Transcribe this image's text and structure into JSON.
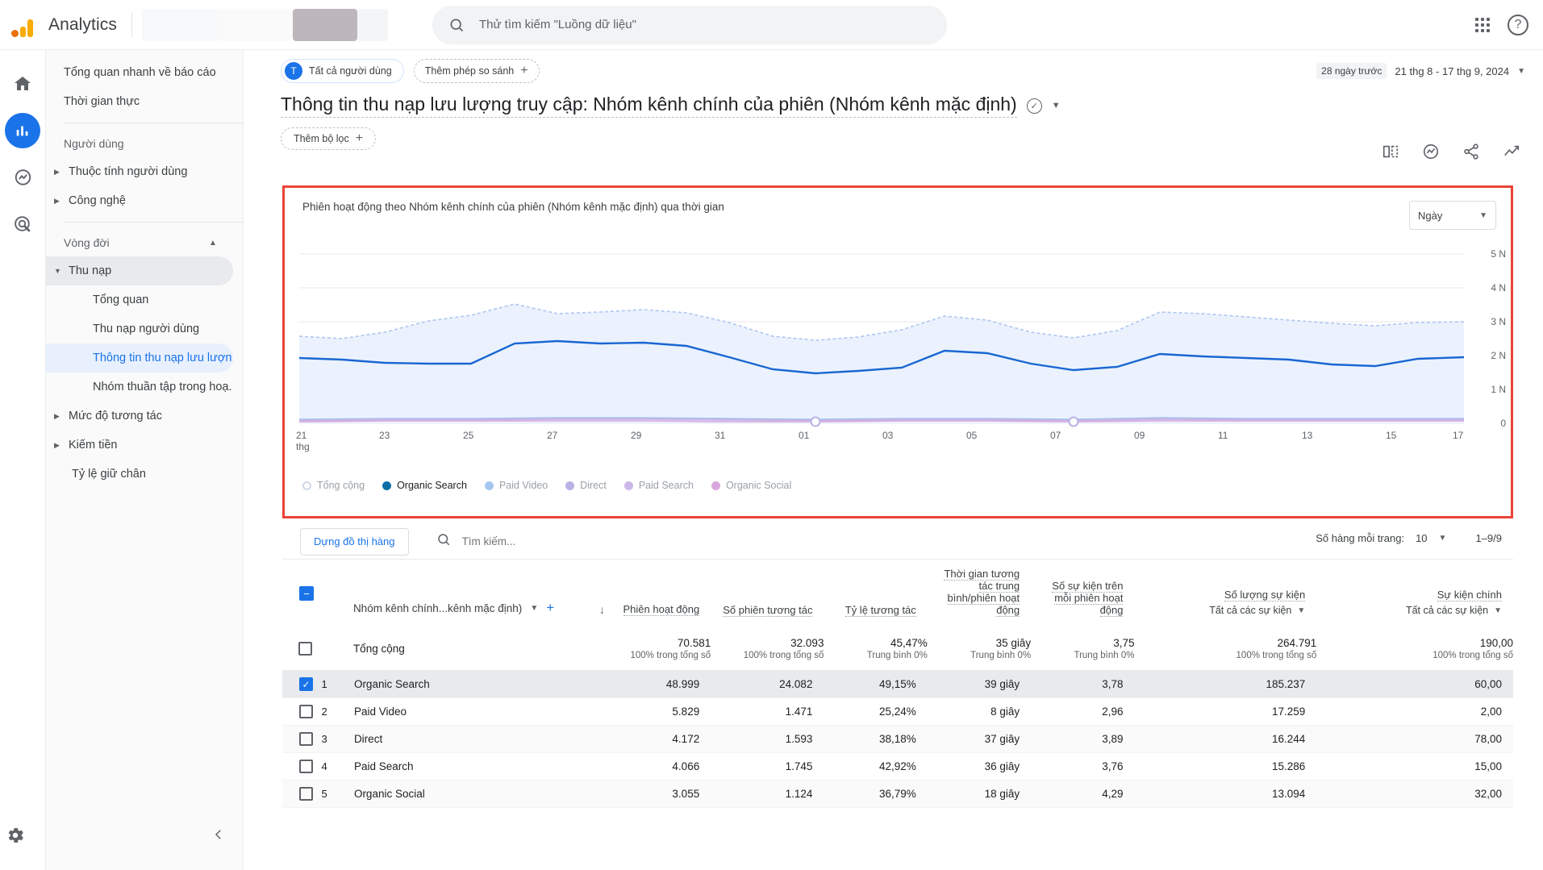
{
  "topbar": {
    "brand": "Analytics",
    "search_placeholder": "Thử tìm kiếm \"Luồng dữ liệu\"",
    "search_value": "",
    "search_icon": "search-icon",
    "apps_icon": "apps-grid-icon",
    "help_icon": "help-icon"
  },
  "rail": {
    "items": [
      {
        "name": "home",
        "icon": "home-icon"
      },
      {
        "name": "reports",
        "icon": "bar-chart-icon"
      },
      {
        "name": "explore",
        "icon": "explore-icon"
      },
      {
        "name": "advertising",
        "icon": "advertising-icon"
      }
    ],
    "settings_icon": "gear-icon"
  },
  "sidebar": {
    "items": [
      {
        "label": "Tổng quan nhanh về báo cáo",
        "type": "link"
      },
      {
        "label": "Thời gian thực",
        "type": "link"
      },
      {
        "label": "Người dùng",
        "type": "group"
      },
      {
        "label": "Thuộc tính người dùng",
        "type": "expandable"
      },
      {
        "label": "Công nghệ",
        "type": "expandable"
      },
      {
        "label": "Vòng đời",
        "type": "group"
      },
      {
        "label": "Thu nạp",
        "type": "expanded"
      },
      {
        "label": "Tổng quan",
        "type": "sub"
      },
      {
        "label": "Thu nạp người dùng",
        "type": "sub"
      },
      {
        "label": "Thông tin thu nạp lưu lượn...",
        "type": "sub-selected"
      },
      {
        "label": "Nhóm thuần tập trong hoạ...",
        "type": "sub"
      },
      {
        "label": "Mức độ tương tác",
        "type": "expandable"
      },
      {
        "label": "Kiếm tiền",
        "type": "expandable"
      },
      {
        "label": "Tỷ lệ giữ chân",
        "type": "link"
      }
    ],
    "collapse_icon": "chevron-left-icon"
  },
  "comparison": {
    "all_users_label": "Tất cả người dùng",
    "all_users_initial": "T",
    "add_comparison_label": "Thêm phép so sánh",
    "add_icon": "plus-icon"
  },
  "date_range": {
    "badge": "28 ngày trước",
    "range": "21 thg 8 - 17 thg 9, 2024",
    "caret_icon": "chevron-down-icon"
  },
  "report": {
    "title": "Thông tin thu nạp lưu lượng truy cập: Nhóm kênh chính của phiên (Nhóm kênh mặc định)",
    "verified_icon": "check-circle-icon",
    "title_caret_icon": "chevron-down-icon",
    "filter_label": "Thêm bộ lọc",
    "filter_plus_icon": "plus-icon",
    "actions": [
      {
        "name": "compare-icon"
      },
      {
        "name": "insights-icon"
      },
      {
        "name": "share-icon"
      },
      {
        "name": "trend-icon"
      }
    ]
  },
  "chart_data": {
    "type": "line",
    "title": "Phiên hoạt động theo Nhóm kênh chính của phiên (Nhóm kênh mặc định) qua thời gian",
    "granularity_label": "Ngày",
    "granularity_caret_icon": "chevron-down-icon",
    "xlabel": "",
    "ylabel": "",
    "ylim": [
      0,
      5000
    ],
    "yticks": [
      0,
      1000,
      2000,
      3000,
      4000,
      5000
    ],
    "ytick_labels": [
      "0",
      "1 N",
      "2 N",
      "3 N",
      "4 N",
      "5 N"
    ],
    "x_unit_note": "thg",
    "x": [
      "21",
      "22",
      "23",
      "24",
      "25",
      "26",
      "27",
      "28",
      "29",
      "30",
      "31",
      "01",
      "02",
      "03",
      "04",
      "05",
      "06",
      "07",
      "08",
      "09",
      "10",
      "11",
      "12",
      "13",
      "14",
      "15",
      "16",
      "17"
    ],
    "xtick_labels": [
      "21",
      "23",
      "25",
      "27",
      "29",
      "31",
      "01",
      "03",
      "05",
      "07",
      "09",
      "11",
      "13",
      "15",
      "17"
    ],
    "grid": true,
    "legend_position": "bottom",
    "series": [
      {
        "name": "Tổng cộng",
        "color": "#cfd8e8",
        "style": "dotted-area",
        "active": false,
        "values": [
          2560,
          2500,
          2690,
          3030,
          3190,
          3520,
          3250,
          3290,
          3360,
          3280,
          2990,
          2600,
          2450,
          2550,
          2760,
          3170,
          3060,
          2700,
          2520,
          2750,
          3280,
          3230,
          3130,
          3050,
          2960,
          2880,
          2980,
          3000
        ]
      },
      {
        "name": "Organic Search",
        "color": "#1a73e8",
        "style": "line",
        "active": true,
        "values": [
          1930,
          1880,
          1790,
          1770,
          1760,
          2350,
          2420,
          2360,
          2380,
          2280,
          1960,
          1600,
          1480,
          1560,
          1640,
          2130,
          2060,
          1760,
          1560,
          1660,
          2040,
          1980,
          1930,
          1880,
          1750,
          1700,
          1900,
          1950
        ]
      },
      {
        "name": "Paid Video",
        "color": "#a7c7f2",
        "style": "line",
        "active": false,
        "values": [
          120,
          125,
          130,
          135,
          130,
          140,
          150,
          145,
          150,
          145,
          135,
          120,
          115,
          118,
          125,
          140,
          135,
          125,
          118,
          128,
          145,
          143,
          138,
          133,
          128,
          124,
          132,
          135
        ]
      },
      {
        "name": "Direct",
        "color": "#b9b2e5",
        "style": "line",
        "active": false,
        "values": [
          105,
          108,
          112,
          118,
          116,
          124,
          130,
          128,
          132,
          126,
          118,
          105,
          100,
          103,
          110,
          122,
          118,
          108,
          101,
          110,
          127,
          124,
          120,
          116,
          112,
          108,
          115,
          118
        ]
      },
      {
        "name": "Paid Search",
        "color": "#cbb8e8",
        "style": "line",
        "active": false,
        "values": [
          98,
          100,
          104,
          110,
          108,
          116,
          122,
          120,
          124,
          118,
          110,
          98,
          93,
          96,
          103,
          114,
          110,
          100,
          94,
          103,
          119,
          116,
          112,
          108,
          104,
          100,
          107,
          110
        ]
      },
      {
        "name": "Organic Social",
        "color": "#d9a7dd",
        "style": "line",
        "active": false,
        "values": [
          82,
          85,
          88,
          93,
          91,
          98,
          104,
          102,
          106,
          100,
          93,
          82,
          78,
          81,
          87,
          97,
          93,
          84,
          79,
          87,
          101,
          98,
          95,
          91,
          88,
          84,
          90,
          93
        ]
      }
    ]
  },
  "table": {
    "build_chart_button": "Dựng đồ thị hàng",
    "search_placeholder": "Tìm kiếm...",
    "search_icon": "search-icon",
    "search_value": "",
    "rows_per_page_label": "Số hàng mỗi trang:",
    "rows_per_page_value": "10",
    "rows_per_page_caret_icon": "chevron-down-icon",
    "pagination": "1–9/9",
    "dimension_label": "Nhóm kênh chính...kênh mặc định)",
    "dimension_caret_icon": "chevron-down-icon",
    "dimension_add_icon": "plus-icon",
    "sort_icon": "arrow-down-icon",
    "columns": [
      {
        "label": "Phiên hoạt động",
        "sub": ""
      },
      {
        "label": "Số phiên tương tác",
        "sub": ""
      },
      {
        "label": "Tỷ lệ tương tác",
        "sub": ""
      },
      {
        "label": "Thời gian tương tác trung bình/phiên hoạt động",
        "sub": ""
      },
      {
        "label": "Số sự kiện trên mỗi phiên hoạt động",
        "sub": ""
      },
      {
        "label": "Số lượng sự kiện",
        "sub": "Tất cả các sự kiện"
      },
      {
        "label": "Sự kiện chính",
        "sub": "Tất cả các sự kiện"
      }
    ],
    "totals": {
      "label": "Tổng cộng",
      "values": [
        "70.581",
        "32.093",
        "45,47%",
        "35 giây",
        "3,75",
        "264.791",
        "190,00"
      ],
      "subs": [
        "100% trong tổng số",
        "100% trong tổng số",
        "Trung bình 0%",
        "Trung bình 0%",
        "Trung bình 0%",
        "100% trong tổng số",
        "100% trong tổng số"
      ]
    },
    "rows": [
      {
        "index": "1",
        "name": "Organic Search",
        "selected": true,
        "values": [
          "48.999",
          "24.082",
          "49,15%",
          "39 giây",
          "3,78",
          "185.237",
          "60,00"
        ]
      },
      {
        "index": "2",
        "name": "Paid Video",
        "selected": false,
        "values": [
          "5.829",
          "1.471",
          "25,24%",
          "8 giây",
          "2,96",
          "17.259",
          "2,00"
        ]
      },
      {
        "index": "3",
        "name": "Direct",
        "selected": false,
        "values": [
          "4.172",
          "1.593",
          "38,18%",
          "37 giây",
          "3,89",
          "16.244",
          "78,00"
        ]
      },
      {
        "index": "4",
        "name": "Paid Search",
        "selected": false,
        "values": [
          "4.066",
          "1.745",
          "42,92%",
          "36 giây",
          "3,76",
          "15.286",
          "15,00"
        ]
      },
      {
        "index": "5",
        "name": "Organic Social",
        "selected": false,
        "values": [
          "3.055",
          "1.124",
          "36,79%",
          "18 giây",
          "4,29",
          "13.094",
          "32,00"
        ]
      }
    ]
  }
}
